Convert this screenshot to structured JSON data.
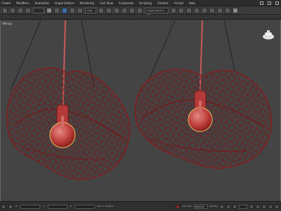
{
  "menu": {
    "items": [
      "Create",
      "Modifiers",
      "Animation",
      "Graph Editors",
      "Rendering",
      "Civil View",
      "Customize",
      "Scripting",
      "Content",
      "Arnold",
      "Help"
    ]
  },
  "toolbar": {
    "selection_set": "Create Selection Set",
    "view_dropdown": "View"
  },
  "viewport": {
    "label": "[Persp]"
  },
  "status": {
    "x_label": "X:",
    "y_label": "Y:",
    "z_label": "Z:",
    "grid": "Grid = 10,0mm",
    "auto_key": "Auto Key",
    "set_key": "Set Key",
    "selected": "Selected"
  },
  "colors": {
    "wire": "#8a1a1a",
    "bulb": "#c8504e",
    "background": "#444444"
  },
  "icons": [
    "undo-icon",
    "redo-icon",
    "link-icon",
    "select-icon",
    "move-icon",
    "rotate-icon",
    "scale-icon",
    "snap-icon",
    "mirror-icon",
    "align-icon",
    "render-icon",
    "teapot-icon"
  ]
}
